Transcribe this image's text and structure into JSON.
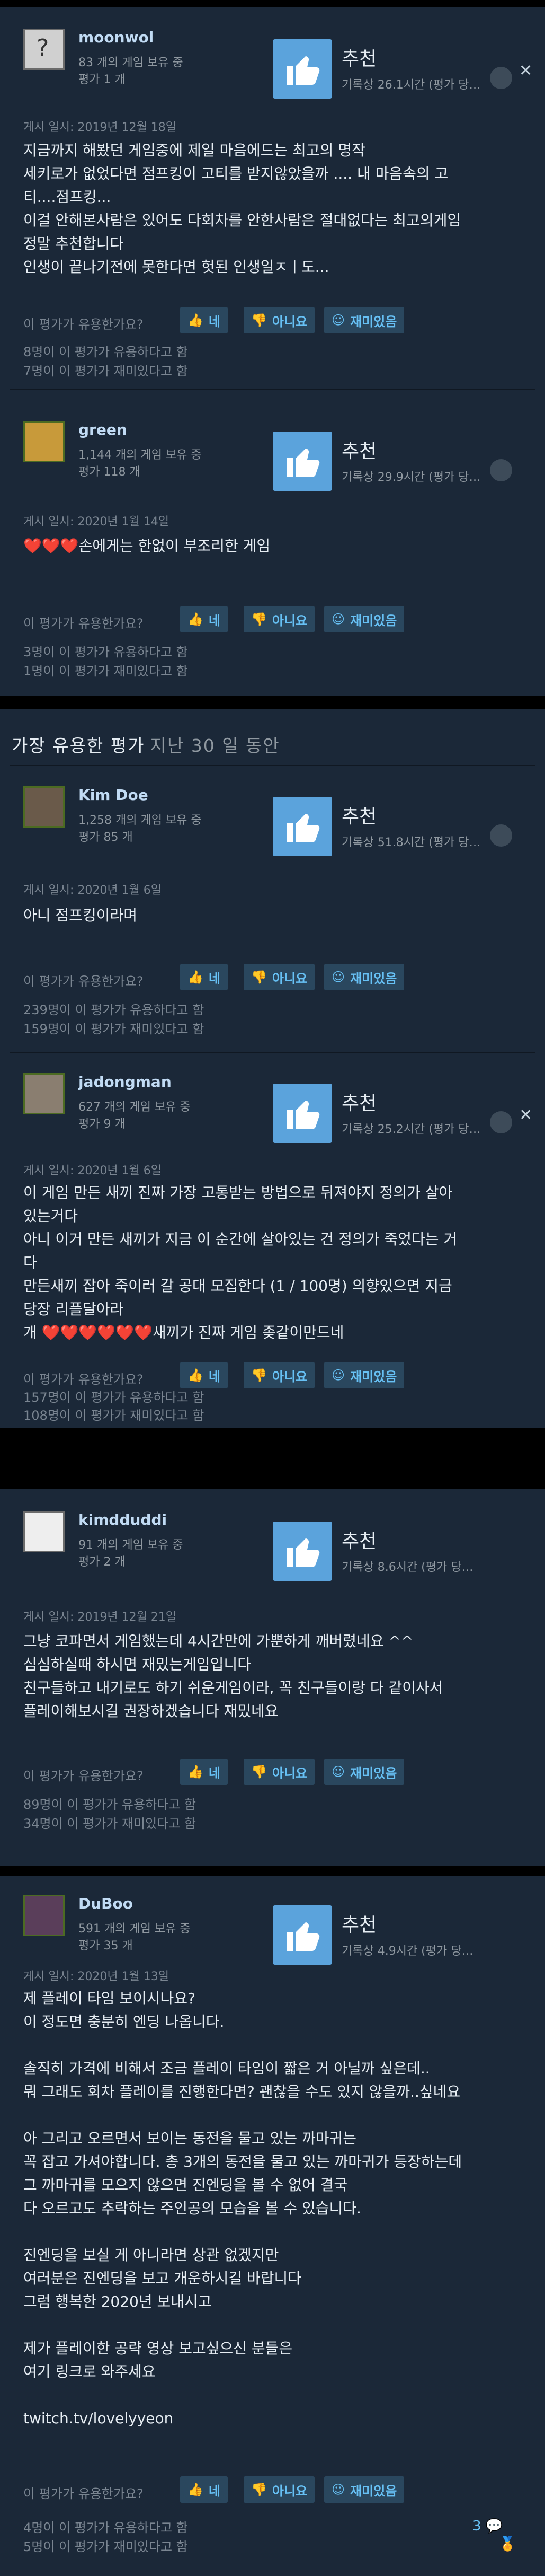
{
  "labels": {
    "recommended": "추천",
    "helpful_question": "이 평가가 유용한가요?",
    "yes": "네",
    "no": "아니요",
    "funny": "재미있음",
    "section_title": "가장 유용한 평가",
    "section_subtitle": "지난 30 일 동안",
    "close": "✕"
  },
  "reviews": [
    {
      "user": "moonwol",
      "games": "83 개의 게임 보유 중",
      "reviews_count": "평가 1 개",
      "hours": "기록상 26.1시간 (평가 당…",
      "posted": "게시 일시: 2019년 12월 18일",
      "body": [
        "지금까지 해봤던 게임중에 제일 마음에드는 최고의 명작",
        "세키로가 없었다면 점프킹이 고티를 받지않았을까 .... 내 마음속의 고",
        "티....점프킹...",
        "이걸 안해본사람은 있어도 다회차를 안한사람은 절대없다는 최고의게임",
        "정말 추천합니다",
        "인생이 끝나기전에 못한다면 헛된 인생일ㅈㅣ도..."
      ],
      "stat_helpful": "8명이 이 평가가 유용하다고 함",
      "stat_funny": "7명이 이 평가가 재미있다고 함"
    },
    {
      "user": "green",
      "games": "1,144 개의 게임 보유 중",
      "reviews_count": "평가 118 개",
      "hours": "기록상 29.9시간 (평가 당…",
      "posted": "게시 일시: 2020년 1월 14일",
      "body": [
        "❤️❤️❤️손에게는 한없이 부조리한 게임"
      ],
      "stat_helpful": "3명이 이 평가가 유용하다고 함",
      "stat_funny": "1명이 이 평가가 재미있다고 함"
    },
    {
      "user": "Kim Doe",
      "games": "1,258 개의 게임 보유 중",
      "reviews_count": "평가 85 개",
      "hours": "기록상 51.8시간 (평가 당…",
      "posted": "게시 일시: 2020년 1월 6일",
      "body": [
        "아니 점프킹이라며"
      ],
      "stat_helpful": "239명이 이 평가가 유용하다고 함",
      "stat_funny": "159명이 이 평가가 재미있다고 함"
    },
    {
      "user": "jadongman",
      "games": "627 개의 게임 보유 중",
      "reviews_count": "평가 9 개",
      "hours": "기록상 25.2시간 (평가 당…",
      "posted": "게시 일시: 2020년 1월 6일",
      "body": [
        "이 게임 만든 새끼 진짜 가장 고통받는 방법으로 뒤져야지 정의가 살아",
        "있는거다",
        "아니 이거 만든 새끼가 지금 이 순간에 살아있는 건 정의가 죽었다는 거",
        "다",
        "만든새끼 잡아 죽이러 갈 공대 모집한다 (1 / 100명) 의향있으면 지금",
        "당장 리플달아라",
        "개 ❤️❤️❤️❤️❤️❤️새끼가 진짜 게임 좆같이만드네"
      ],
      "stat_helpful": "157명이 이 평가가 유용하다고 함",
      "stat_funny": "108명이 이 평가가 재미있다고 함"
    },
    {
      "user": "kimdduddi",
      "games": "91 개의 게임 보유 중",
      "reviews_count": "평가 2 개",
      "hours": "기록상 8.6시간 (평가 당…",
      "posted": "게시 일시: 2019년 12월 21일",
      "body": [
        "그냥 코파면서 게임했는데 4시간만에 가뿐하게 깨버렸네요 ^^",
        "심심하실때 하시면 재밌는게임입니다",
        "친구들하고 내기로도 하기 쉬운게임이라, 꼭 친구들이랑 다 같이사서",
        "플레이해보시길 권장하겠습니다 재밌네요"
      ],
      "stat_helpful": "89명이 이 평가가 유용하다고 함",
      "stat_funny": "34명이 이 평가가 재미있다고 함"
    },
    {
      "user": "DuBoo",
      "games": "591 개의 게임 보유 중",
      "reviews_count": "평가 35 개",
      "hours": "기록상 4.9시간 (평가 당…",
      "posted": "게시 일시: 2020년 1월 13일",
      "body": [
        "제 플레이 타임 보이시나요?",
        "이 정도면 충분히 엔딩 나옵니다.",
        "",
        "솔직히 가격에 비해서 조금 플레이 타임이 짧은 거 아닐까 싶은데..",
        "뭐 그래도 회차 플레이를 진행한다면? 괜찮을 수도 있지 않을까..싶네요",
        "",
        "아 그리고 오르면서 보이는 동전을 물고 있는 까마귀는",
        "꼭 잡고 가셔야합니다. 총 3개의 동전을 물고 있는 까마귀가 등장하는데",
        "그 까마귀를 모으지 않으면 진엔딩을 볼 수 없어 결국",
        "다 오르고도 추락하는 주인공의 모습을 볼 수 있습니다.",
        "",
        "진엔딩을 보실 게 아니라면 상관 없겠지만",
        "여러분은 진엔딩을 보고 개운하시길 바랍니다",
        "그럼 행복한 2020년 보내시고",
        "",
        "제가 플레이한 공략 영상 보고싶으신 분들은",
        "여기 링크로 와주세요",
        "",
        "twitch.tv/lovelyyeon"
      ],
      "stat_helpful": "4명이 이 평가가 유용하다고 함",
      "stat_funny": "5명이 이 평가가 재미있다고 함",
      "comment_count": "3"
    }
  ]
}
